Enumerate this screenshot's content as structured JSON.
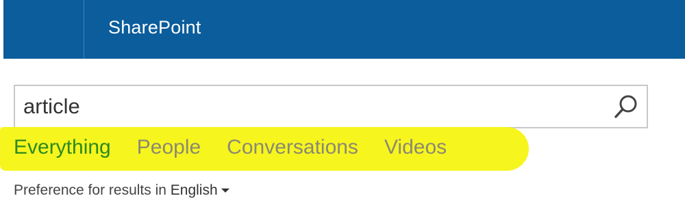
{
  "suite_bar": {
    "brand": "SharePoint"
  },
  "search": {
    "query": "article",
    "button_icon": "search-icon"
  },
  "verticals": [
    {
      "label": "Everything",
      "active": true
    },
    {
      "label": "People",
      "active": false
    },
    {
      "label": "Conversations",
      "active": false
    },
    {
      "label": "Videos",
      "active": false
    }
  ],
  "preference": {
    "text": "Preference for results in",
    "language": "English"
  },
  "colors": {
    "suite_bar": "#0b5d9c",
    "highlight": "#f7f51e",
    "active_tab": "#2b8a1e",
    "inactive_tab": "#8a8a70"
  }
}
